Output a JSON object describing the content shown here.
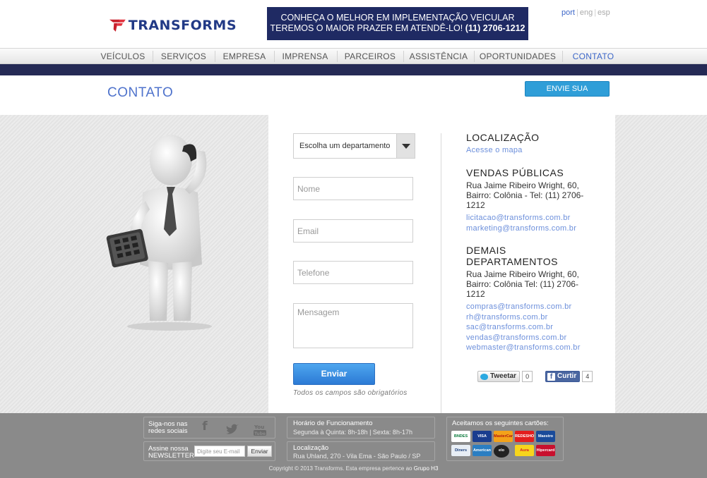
{
  "header": {
    "logo_text": "TRANSFORMS",
    "banner_line1": "CONHEÇA O MELHOR EM IMPLEMENTAÇÃO VEICULAR",
    "banner_line2": "TEREMOS O MAIOR PRAZER EM ATENDÊ-LO!",
    "banner_phone": "(11) 2706-1212",
    "languages": [
      "port",
      "eng",
      "esp"
    ],
    "active_language": "port"
  },
  "nav": {
    "items": [
      "VEÍCULOS",
      "SERVIÇOS",
      "EMPRESA",
      "IMPRENSA",
      "PARCEIROS",
      "ASSISTÊNCIA",
      "OPORTUNIDADES",
      "CONTATO"
    ],
    "active": "CONTATO"
  },
  "page": {
    "title": "CONTATO",
    "proposal_button": "ENVIE SUA PROPOSTA"
  },
  "form": {
    "department_select": "Escolha um departamento",
    "name_placeholder": "Nome",
    "email_placeholder": "Email",
    "phone_placeholder": "Telefone",
    "message_placeholder": "Mensagem",
    "submit_label": "Enviar",
    "required_note": "Todos os campos são obrigatórios"
  },
  "info": {
    "location_title": "LOCALIZAÇÃO",
    "map_link": "Acesse o mapa",
    "public_sales_title": "VENDAS PÚBLICAS",
    "public_sales_address": "Rua Jaime Ribeiro Wright, 60, Bairro: Colônia - Tel: (11) 2706-1212",
    "public_sales_emails": [
      "licitacao@transforms.com.br",
      "marketing@transforms.com.br"
    ],
    "other_depts_title": "DEMAIS DEPARTAMENTOS",
    "other_depts_address": "Rua Jaime Ribeiro Wright, 60, Bairro: Colônia Tel: (11) 2706-1212",
    "other_depts_emails": [
      "compras@transforms.com.br",
      "rh@transforms.com.br",
      "sac@transforms.com.br",
      "vendas@transforms.com.br",
      "webmaster@transforms.com.br"
    ]
  },
  "social_share": {
    "tweet_label": "Tweetar",
    "tweet_count": "0",
    "like_label": "Curtir",
    "like_count": "4"
  },
  "footer": {
    "follow_label_1": "Siga-nos nas",
    "follow_label_2": "redes sociais",
    "social_icons": [
      "facebook-icon",
      "twitter-icon",
      "youtube-icon"
    ],
    "newsletter_label_1": "Assine nossa",
    "newsletter_label_2": "NEWSLETTER",
    "newsletter_placeholder": "Digite seu E-mail",
    "newsletter_button": "Enviar",
    "hours_title": "Horário de Funcionamento",
    "hours_text": "Segunda à Quinta: 8h-18h | Sexta: 8h-17h",
    "location_title": "Localização",
    "location_text": "Rua Uhland, 270 - Vila Ema - São Paulo / SP",
    "cards_title": "Aceitamos os seguintes cartões:",
    "cards": [
      "BNDES",
      "VISA",
      "MasterCard",
      "REDESHOP",
      "Maestro",
      "Diners Club",
      "American Express",
      "elo",
      "Aura",
      "Hipercard"
    ],
    "copyright_prefix": "Copyright © 2013 Transforms. Esta empresa pertence ao",
    "copyright_group": "Grupo H3"
  }
}
